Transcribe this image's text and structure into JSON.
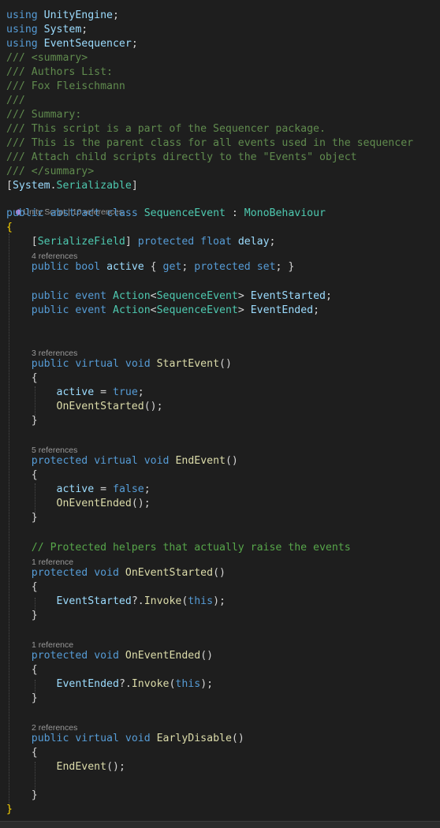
{
  "editor": {
    "lens": {
      "unity_script": "Unity Script | 10 references",
      "refs_4": "4 references",
      "refs_3": "3 references",
      "refs_5": "5 references",
      "refs_1a": "1 reference",
      "refs_1b": "1 reference",
      "refs_2": "2 references"
    },
    "icons": {
      "unity": "unity-script-icon"
    },
    "code": [
      [
        [
          "kw",
          "using"
        ],
        [
          "pn",
          " "
        ],
        [
          "id",
          "UnityEngine"
        ],
        [
          "pn",
          ";"
        ]
      ],
      [
        [
          "kw",
          "using"
        ],
        [
          "pn",
          " "
        ],
        [
          "id",
          "System"
        ],
        [
          "pn",
          ";"
        ]
      ],
      [
        [
          "kw",
          "using"
        ],
        [
          "pn",
          " "
        ],
        [
          "id",
          "EventSequencer"
        ],
        [
          "pn",
          ";"
        ]
      ],
      [
        [
          "xc",
          "/// "
        ],
        [
          "xc",
          "<summary>"
        ]
      ],
      [
        [
          "xc",
          "/// Authors List:"
        ]
      ],
      [
        [
          "xc",
          "/// Fox Fleischmann"
        ]
      ],
      [
        [
          "xc",
          "///"
        ]
      ],
      [
        [
          "xc",
          "/// Summary:"
        ]
      ],
      [
        [
          "xc",
          "/// This script is a part of the Sequencer package."
        ]
      ],
      [
        [
          "xc",
          "/// This is the parent class for all events used in the sequencer"
        ]
      ],
      [
        [
          "xc",
          "/// Attach child scripts directly to the \"Events\" object"
        ]
      ],
      [
        [
          "xc",
          "/// "
        ],
        [
          "xc",
          "</summary>"
        ]
      ],
      [
        [
          "pn",
          "["
        ],
        [
          "id",
          "System"
        ],
        [
          "pn",
          "."
        ],
        [
          "ty",
          "Serializable"
        ],
        [
          "pn",
          "]"
        ]
      ],
      [
        [
          "kw",
          "public"
        ],
        [
          "pn",
          " "
        ],
        [
          "kw",
          "abstract"
        ],
        [
          "pn",
          " "
        ],
        [
          "kw",
          "class"
        ],
        [
          "pn",
          " "
        ],
        [
          "ty",
          "SequenceEvent"
        ],
        [
          "pn",
          " : "
        ],
        [
          "ty",
          "MonoBehaviour"
        ]
      ],
      [
        [
          "br",
          "{"
        ]
      ],
      [
        [
          "pn",
          "    ["
        ],
        [
          "ty",
          "SerializeField"
        ],
        [
          "pn",
          "] "
        ],
        [
          "kw",
          "protected"
        ],
        [
          "pn",
          " "
        ],
        [
          "kw",
          "float"
        ],
        [
          "pn",
          " "
        ],
        [
          "id",
          "delay"
        ],
        [
          "pn",
          ";"
        ]
      ],
      [
        [
          "pn",
          "    "
        ],
        [
          "kw",
          "public"
        ],
        [
          "pn",
          " "
        ],
        [
          "kw",
          "bool"
        ],
        [
          "pn",
          " "
        ],
        [
          "id",
          "active"
        ],
        [
          "pn",
          " { "
        ],
        [
          "kw",
          "get"
        ],
        [
          "pn",
          "; "
        ],
        [
          "kw",
          "protected"
        ],
        [
          "pn",
          " "
        ],
        [
          "kw",
          "set"
        ],
        [
          "pn",
          "; }"
        ]
      ],
      [],
      [
        [
          "pn",
          "    "
        ],
        [
          "kw",
          "public"
        ],
        [
          "pn",
          " "
        ],
        [
          "kw",
          "event"
        ],
        [
          "pn",
          " "
        ],
        [
          "ty",
          "Action"
        ],
        [
          "pn",
          "<"
        ],
        [
          "ty",
          "SequenceEvent"
        ],
        [
          "pn",
          "> "
        ],
        [
          "id",
          "EventStarted"
        ],
        [
          "pn",
          ";"
        ]
      ],
      [
        [
          "pn",
          "    "
        ],
        [
          "kw",
          "public"
        ],
        [
          "pn",
          " "
        ],
        [
          "kw",
          "event"
        ],
        [
          "pn",
          " "
        ],
        [
          "ty",
          "Action"
        ],
        [
          "pn",
          "<"
        ],
        [
          "ty",
          "SequenceEvent"
        ],
        [
          "pn",
          "> "
        ],
        [
          "id",
          "EventEnded"
        ],
        [
          "pn",
          ";"
        ]
      ],
      [
        [
          "pn",
          "    "
        ],
        [
          "kw",
          "public"
        ],
        [
          "pn",
          " "
        ],
        [
          "kw",
          "virtual"
        ],
        [
          "pn",
          " "
        ],
        [
          "kw",
          "void"
        ],
        [
          "pn",
          " "
        ],
        [
          "fn",
          "StartEvent"
        ],
        [
          "pn",
          "()"
        ]
      ],
      [
        [
          "pn",
          "    {"
        ]
      ],
      [
        [
          "pn",
          "        "
        ],
        [
          "id",
          "active"
        ],
        [
          "pn",
          " = "
        ],
        [
          "kw",
          "true"
        ],
        [
          "pn",
          ";"
        ]
      ],
      [
        [
          "pn",
          "        "
        ],
        [
          "fn",
          "OnEventStarted"
        ],
        [
          "pn",
          "();"
        ]
      ],
      [
        [
          "pn",
          "    }"
        ]
      ],
      [
        [
          "pn",
          "    "
        ],
        [
          "kw",
          "protected"
        ],
        [
          "pn",
          " "
        ],
        [
          "kw",
          "virtual"
        ],
        [
          "pn",
          " "
        ],
        [
          "kw",
          "void"
        ],
        [
          "pn",
          " "
        ],
        [
          "fn",
          "EndEvent"
        ],
        [
          "pn",
          "()"
        ]
      ],
      [
        [
          "pn",
          "    {"
        ]
      ],
      [
        [
          "pn",
          "        "
        ],
        [
          "id",
          "active"
        ],
        [
          "pn",
          " = "
        ],
        [
          "kw",
          "false"
        ],
        [
          "pn",
          ";"
        ]
      ],
      [
        [
          "pn",
          "        "
        ],
        [
          "fn",
          "OnEventEnded"
        ],
        [
          "pn",
          "();"
        ]
      ],
      [
        [
          "pn",
          "    }"
        ]
      ],
      [
        [
          "pn",
          "    "
        ],
        [
          "cm",
          "// Protected helpers that actually raise the events"
        ]
      ],
      [
        [
          "pn",
          "    "
        ],
        [
          "kw",
          "protected"
        ],
        [
          "pn",
          " "
        ],
        [
          "kw",
          "void"
        ],
        [
          "pn",
          " "
        ],
        [
          "fn",
          "OnEventStarted"
        ],
        [
          "pn",
          "()"
        ]
      ],
      [
        [
          "pn",
          "    {"
        ]
      ],
      [
        [
          "pn",
          "        "
        ],
        [
          "id",
          "EventStarted"
        ],
        [
          "pn",
          "?."
        ],
        [
          "fn",
          "Invoke"
        ],
        [
          "pn",
          "("
        ],
        [
          "kw",
          "this"
        ],
        [
          "pn",
          ");"
        ]
      ],
      [
        [
          "pn",
          "    }"
        ]
      ],
      [
        [
          "pn",
          "    "
        ],
        [
          "kw",
          "protected"
        ],
        [
          "pn",
          " "
        ],
        [
          "kw",
          "void"
        ],
        [
          "pn",
          " "
        ],
        [
          "fn",
          "OnEventEnded"
        ],
        [
          "pn",
          "()"
        ]
      ],
      [
        [
          "pn",
          "    {"
        ]
      ],
      [
        [
          "pn",
          "        "
        ],
        [
          "id",
          "EventEnded"
        ],
        [
          "pn",
          "?."
        ],
        [
          "fn",
          "Invoke"
        ],
        [
          "pn",
          "("
        ],
        [
          "kw",
          "this"
        ],
        [
          "pn",
          ");"
        ]
      ],
      [
        [
          "pn",
          "    }"
        ]
      ],
      [
        [
          "pn",
          "    "
        ],
        [
          "kw",
          "public"
        ],
        [
          "pn",
          " "
        ],
        [
          "kw",
          "virtual"
        ],
        [
          "pn",
          " "
        ],
        [
          "kw",
          "void"
        ],
        [
          "pn",
          " "
        ],
        [
          "fn",
          "EarlyDisable"
        ],
        [
          "pn",
          "()"
        ]
      ],
      [
        [
          "pn",
          "    {"
        ]
      ],
      [
        [
          "pn",
          "        "
        ],
        [
          "fn",
          "EndEvent"
        ],
        [
          "pn",
          "();"
        ]
      ],
      [],
      [
        [
          "pn",
          "    }"
        ]
      ],
      [
        [
          "br",
          "}"
        ]
      ]
    ]
  }
}
